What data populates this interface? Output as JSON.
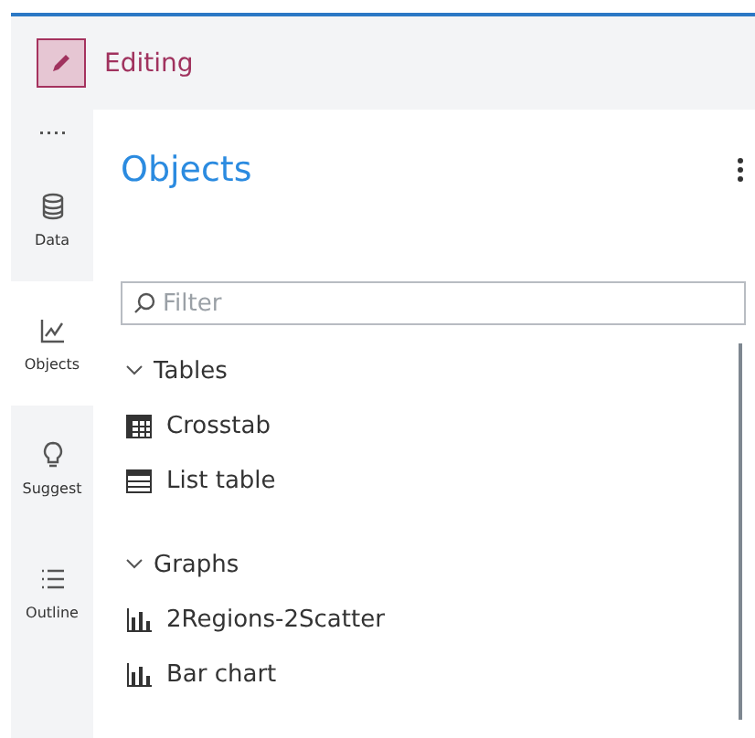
{
  "mode": {
    "label": "Editing"
  },
  "rail": [
    {
      "label": "Data",
      "kind": "database",
      "selected": false
    },
    {
      "label": "Objects",
      "kind": "chart",
      "selected": true
    },
    {
      "label": "Suggest",
      "kind": "bulb",
      "selected": false
    },
    {
      "label": "Outline",
      "kind": "list",
      "selected": false
    }
  ],
  "panel": {
    "title": "Objects",
    "filter": {
      "placeholder": "Filter"
    },
    "groups": [
      {
        "label": "Tables",
        "expanded": true,
        "items": [
          {
            "label": "Crosstab",
            "kind": "grid"
          },
          {
            "label": "List table",
            "kind": "rows"
          }
        ]
      },
      {
        "label": "Graphs",
        "expanded": true,
        "items": [
          {
            "label": "2Regions-2Scatter",
            "kind": "bars"
          },
          {
            "label": "Bar chart",
            "kind": "bars"
          }
        ]
      }
    ]
  }
}
